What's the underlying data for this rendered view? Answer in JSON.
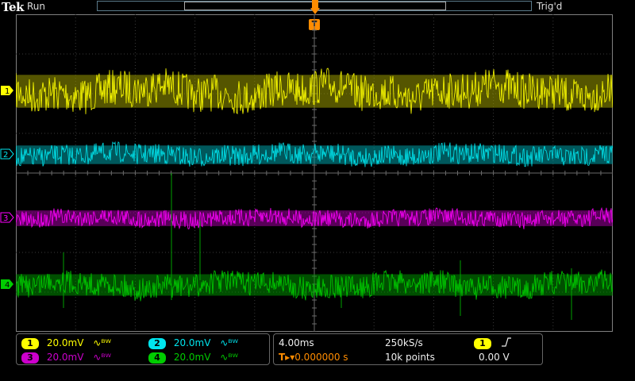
{
  "header": {
    "brand": "Tek",
    "run_status": "Run",
    "trigger_status": "Trig'd",
    "trigger_marker": "T"
  },
  "channels": [
    {
      "id": "1",
      "color": "#ffff00",
      "dim": "#9a9a00",
      "scale": "20.0mV",
      "bw_icon": "∿ᴮᵂ"
    },
    {
      "id": "2",
      "color": "#00e5ee",
      "dim": "#00a0a8",
      "scale": "20.0mV",
      "bw_icon": "∿ᴮᵂ"
    },
    {
      "id": "3",
      "color": "#ff00ff",
      "dim": "#a000a0",
      "scale": "20.0mV",
      "bw_icon": "∿ᴮᵂ"
    },
    {
      "id": "4",
      "color": "#00cc00",
      "dim": "#009000",
      "scale": "20.0mV",
      "bw_icon": "∿ᴮᵂ"
    }
  ],
  "timebase": {
    "scale": "4.00ms",
    "sample_rate": "250kS/s",
    "trigger_delay": "0.000000 s",
    "record_length": "10k points",
    "delay_icon": "T▸▾"
  },
  "trigger": {
    "source": "1",
    "slope_icon": "rising-edge",
    "level": "0.00 V"
  }
}
